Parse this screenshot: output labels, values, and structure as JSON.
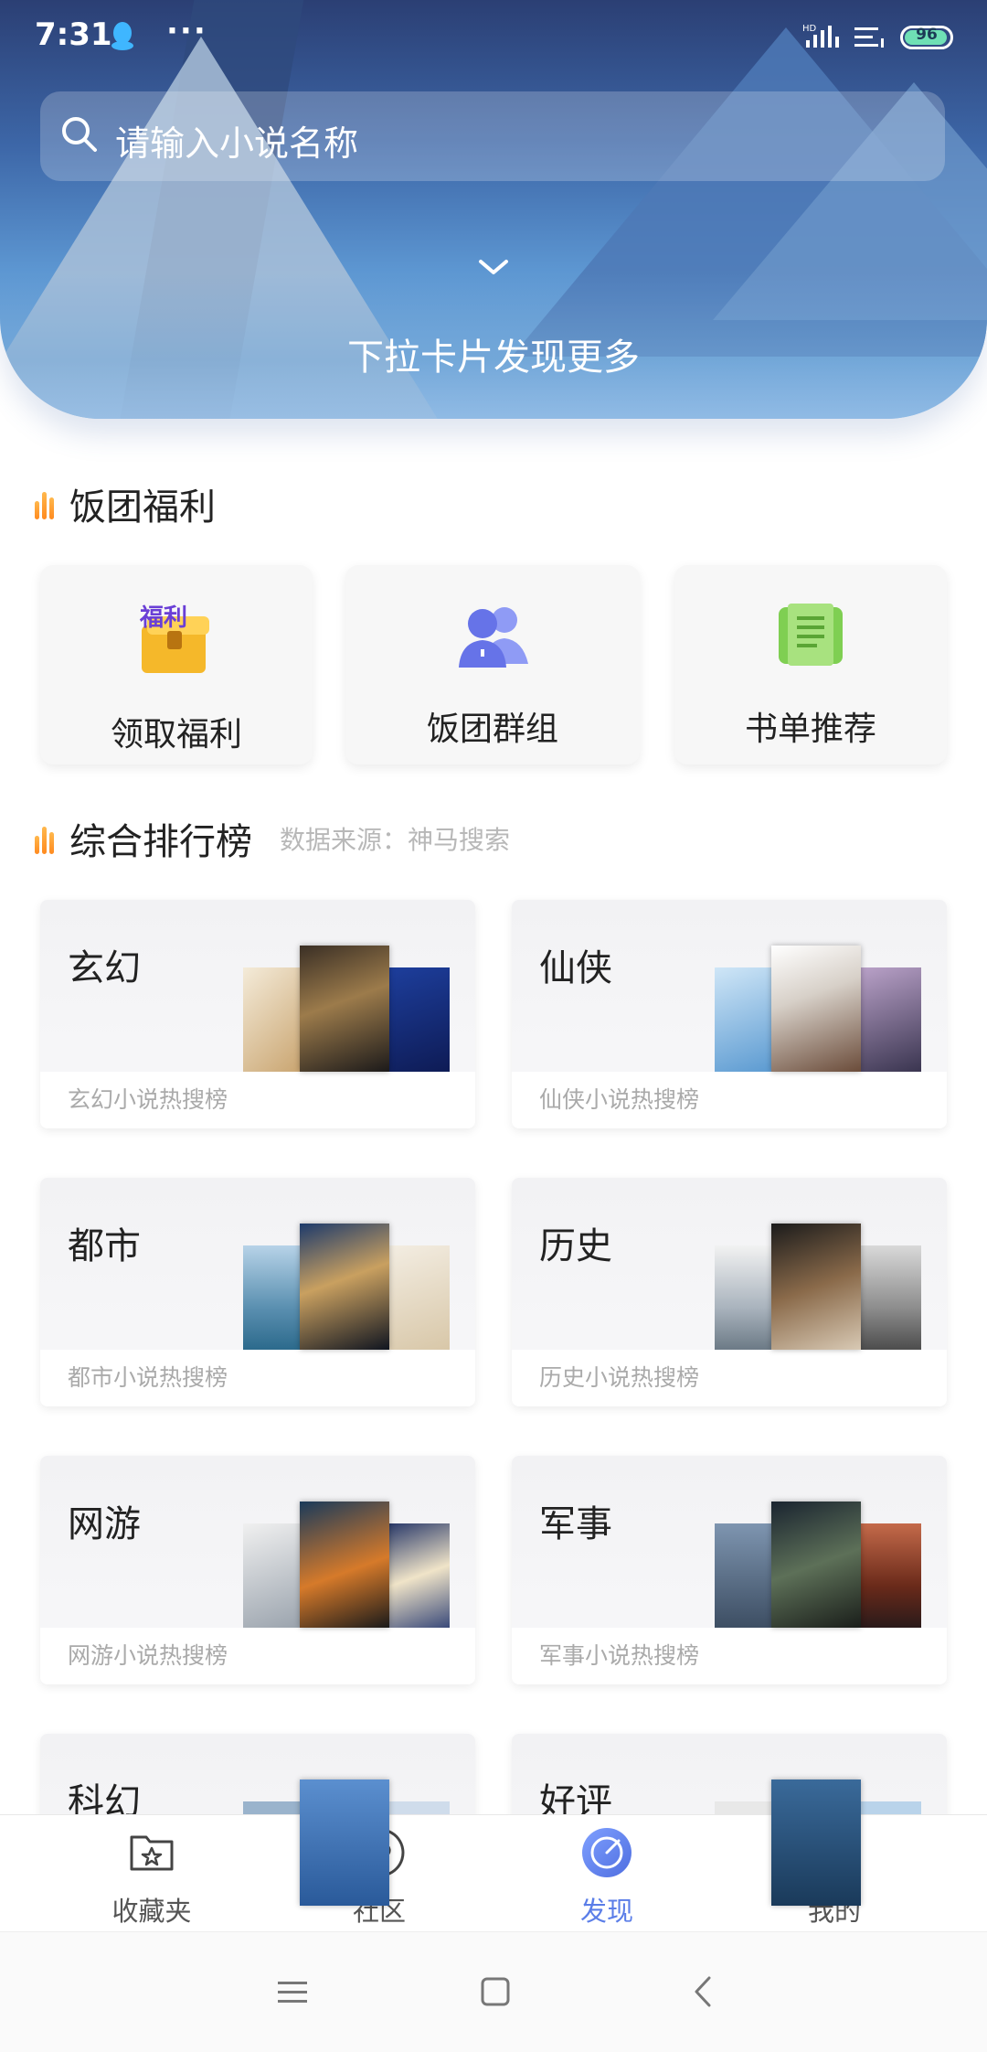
{
  "status_bar": {
    "time": "7:31",
    "more": "···",
    "network": "HD",
    "battery": "96"
  },
  "search": {
    "placeholder": "请输入小说名称"
  },
  "hero": {
    "pull_text": "下拉卡片发现更多"
  },
  "welfare_section": {
    "title": "饭团福利",
    "items": [
      {
        "label": "领取福利",
        "icon": "gift-chest-icon",
        "icon_text": "福利"
      },
      {
        "label": "饭团群组",
        "icon": "group-users-icon"
      },
      {
        "label": "书单推荐",
        "icon": "book-list-icon"
      }
    ]
  },
  "ranking_section": {
    "title": "综合排行榜",
    "source": "数据来源：神马搜索",
    "items": [
      {
        "name": "玄幻",
        "desc": "玄幻小说热搜榜"
      },
      {
        "name": "仙侠",
        "desc": "仙侠小说热搜榜"
      },
      {
        "name": "都市",
        "desc": "都市小说热搜榜"
      },
      {
        "name": "历史",
        "desc": "历史小说热搜榜"
      },
      {
        "name": "网游",
        "desc": "网游小说热搜榜"
      },
      {
        "name": "军事",
        "desc": "军事小说热搜榜"
      },
      {
        "name": "科幻",
        "desc": ""
      },
      {
        "name": "好评",
        "desc": ""
      }
    ]
  },
  "tabbar": {
    "items": [
      {
        "label": "收藏夹",
        "icon": "favorites-folder-icon",
        "active": false
      },
      {
        "label": "社区",
        "icon": "community-heart-icon",
        "active": false
      },
      {
        "label": "发现",
        "icon": "discover-compass-icon",
        "active": true
      },
      {
        "label": "我的",
        "icon": "profile-icon",
        "active": false
      }
    ]
  },
  "colors": {
    "accent": "#5b7ee8",
    "section_bar": "#ff9a2e",
    "hero_top": "#2b3f74",
    "hero_bottom": "#77ace0"
  }
}
